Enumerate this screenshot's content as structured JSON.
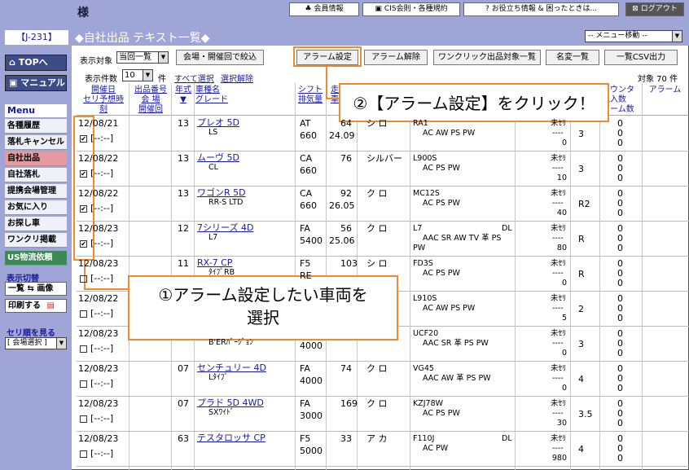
{
  "header": {
    "sama": "様",
    "member_info": "会員情報",
    "cis": "CIS会則・各種規約",
    "useful": "お役立ち情報 & 困ったときは...",
    "logout": "ログアウト"
  },
  "sidebar": {
    "code": "【J-231】",
    "top": "TOPへ",
    "manual": "マニュアル",
    "menu_heading": "Menu",
    "items": [
      "各種履歴",
      "落札キャンセル",
      "自社出品",
      "自社落札",
      "提携会場管理",
      "お気に入り",
      "お探し車",
      "ワンクリ掲載",
      "US物流依頼"
    ],
    "display_switch": "表示切替",
    "list_image": "一覧 ⇆ 画像",
    "print": "印刷する",
    "seri_order": "セリ順を見る",
    "venue_select": "[ 会場選択 ]"
  },
  "page": {
    "title": "◆自社出品  テキスト一覧◆",
    "menu_move": "-- メニュー移動 --"
  },
  "controls": {
    "display_target_label": "表示対象",
    "display_target_value": "当回一覧",
    "venue_filter": "会場・開催回で絞込",
    "alarm_set": "アラーム設定",
    "alarm_release": "アラーム解除",
    "oneclick": "ワンクリック出品対象一覧",
    "name_change": "名変一覧",
    "csv": "一覧CSV出力",
    "count_label": "表示件数",
    "count_value": "10",
    "count_unit": "件",
    "select_all": "すべて選択",
    "deselect": "選択解除",
    "target_count": "対象 70 件"
  },
  "columns": {
    "date": [
      "開催日",
      "セリ予想時刻"
    ],
    "number": [
      "出品番号",
      "会  場",
      "開催回"
    ],
    "year": [
      "年式",
      "▼"
    ],
    "car": [
      "車種名",
      "グレード"
    ],
    "shift": [
      "シフト",
      "排気量"
    ],
    "mileage": [
      "走",
      "車"
    ],
    "count_col": [
      "カウンタ",
      "気入数",
      "ラーム数"
    ],
    "alarm": "アラーム"
  },
  "rows": [
    {
      "date": "12/08/21",
      "time": "[--:--]",
      "checked": true,
      "year": "13",
      "car": "プレオ 5D",
      "grade": "LS",
      "shift": "AT",
      "disp": "660",
      "mil": "64",
      "mil2": "24.09",
      "color": "シ ロ",
      "model": "RA1",
      "equip": "AC AW PS PW",
      "eval": "未ｾﾘ",
      "eval2": "----",
      "eval3": "0",
      "score": "3",
      "c1": "0",
      "c2": "0",
      "c3": "0"
    },
    {
      "date": "12/08/22",
      "time": "[--:--]",
      "checked": true,
      "year": "13",
      "car": "ムーヴ 5D",
      "grade": "CL",
      "shift": "CA",
      "disp": "660",
      "mil": "76",
      "mil2": "",
      "color": "シルバー",
      "model": "L900S",
      "equip": "AC PS PW",
      "eval": "未ｾﾘ",
      "eval2": "----",
      "eval3": "10",
      "score": "3",
      "c1": "0",
      "c2": "0",
      "c3": "0"
    },
    {
      "date": "12/08/22",
      "time": "[--:--]",
      "checked": true,
      "year": "13",
      "car": "ワゴンR 5D",
      "grade": "RR-S LTD",
      "shift": "CA",
      "disp": "660",
      "mil": "92",
      "mil2": "26.05",
      "color": "ク ロ",
      "model": "MC12S",
      "equip": "AC PS PW",
      "eval": "未ｾﾘ",
      "eval2": "----",
      "eval3": "40",
      "score": "R2",
      "c1": "0",
      "c2": "0",
      "c3": "0"
    },
    {
      "date": "12/08/23",
      "time": "[--:--]",
      "checked": true,
      "year": "12",
      "car": "7シリーズ 4D",
      "grade": "L7",
      "shift": "FA",
      "disp": "5400",
      "mil": "56",
      "mil2": "25.06",
      "color": "ク ロ",
      "model": "L7",
      "model_dl": "DL",
      "equip": "AAC SR AW TV 革 PS",
      "equip2": "PW",
      "eval": "未ｾﾘ",
      "eval2": "----",
      "eval3": "80",
      "score": "R",
      "c1": "0",
      "c2": "0",
      "c3": "0"
    },
    {
      "date": "12/08/23",
      "time": "[--:--]",
      "checked": false,
      "year": "11",
      "car": "RX-7 CP",
      "grade": "ﾀｲﾌﾟRB",
      "shift": "F5",
      "disp": "RE",
      "mil": "103",
      "mil2": "",
      "color": "シ ロ",
      "model": "FD3S",
      "equip": "AC PS PW",
      "eval": "未ｾﾘ",
      "eval2": "----",
      "eval3": "0",
      "score": "R",
      "c1": "0",
      "c2": "0",
      "c3": "0"
    },
    {
      "date": "12/08/22",
      "time": "[--:--]",
      "checked": false,
      "year": "",
      "car": "",
      "grade": "",
      "shift": "",
      "disp": "",
      "mil": "",
      "mil2": "",
      "color": "",
      "model": "L910S",
      "equip": "AC AW PS PW",
      "eval": "未ｾﾘ",
      "eval2": "----",
      "eval3": "5",
      "score": "2",
      "c1": "0",
      "c2": "0",
      "c3": "0"
    },
    {
      "date": "12/08/23",
      "time": "[--:--]",
      "checked": false,
      "year": "",
      "car": "",
      "grade": "B'ERﾊﾞｰｼﾞｮﾝ",
      "shift": "",
      "disp": "4000",
      "mil": "",
      "mil2": "",
      "color": "",
      "model": "UCF20",
      "equip": "AAC SR 革 PS PW",
      "eval": "未ｾﾘ",
      "eval2": "----",
      "eval3": "0",
      "score": "3",
      "c1": "0",
      "c2": "0",
      "c3": "0"
    },
    {
      "date": "12/08/23",
      "time": "[--:--]",
      "checked": false,
      "year": "07",
      "car": "センチュリー 4D",
      "grade": "Lﾀｲﾌﾟ",
      "shift": "FA",
      "disp": "4000",
      "mil": "74",
      "mil2": "",
      "color": "ク ロ",
      "model": "VG45",
      "equip": "AAC AW 革 PS PW",
      "eval": "未ｾﾘ",
      "eval2": "----",
      "eval3": "0",
      "score": "4",
      "c1": "0",
      "c2": "0",
      "c3": "0"
    },
    {
      "date": "12/08/23",
      "time": "[--:--]",
      "checked": false,
      "year": "07",
      "car": "プラド 5D 4WD",
      "grade": "SXﾜｲﾄﾞ",
      "shift": "FA",
      "disp": "3000",
      "mil": "169",
      "mil2": "",
      "color": "ク ロ",
      "model": "KZJ78W",
      "equip": "AC PS PW",
      "eval": "未ｾﾘ",
      "eval2": "----",
      "eval3": "30",
      "score": "3.5",
      "c1": "0",
      "c2": "0",
      "c3": "0"
    },
    {
      "date": "12/08/23",
      "time": "[--:--]",
      "checked": false,
      "year": "63",
      "car": "テスタロッサ CP",
      "grade": "",
      "shift": "F5",
      "disp": "5000",
      "mil": "33",
      "mil2": "",
      "color": "ア カ",
      "model": "F110J",
      "model_dl": "DL",
      "equip": "AC PW",
      "eval": "未ｾﾘ",
      "eval2": "----",
      "eval3": "980",
      "score": "4",
      "c1": "0",
      "c2": "0",
      "c3": "0"
    }
  ],
  "callouts": {
    "step1": "①アラーム設定したい車両を選択",
    "step2": "②【アラーム設定】をクリック！"
  },
  "colors": {
    "accent": "#f08a30",
    "nav": "#9fa6d7",
    "link": "#1a1aa0"
  }
}
